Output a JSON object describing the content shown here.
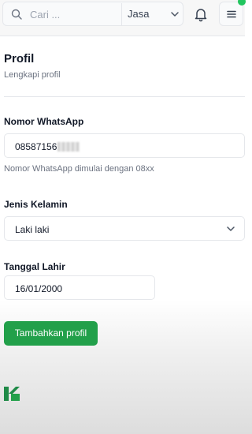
{
  "header": {
    "search": {
      "placeholder": "Cari ..."
    },
    "category": "Jasa",
    "icons": [
      "search-icon",
      "chevron-down-icon",
      "bell-icon",
      "menu-icon"
    ],
    "accent_color": "#22c55e"
  },
  "profile": {
    "title": "Profil",
    "subtitle": "Lengkapi profil"
  },
  "form": {
    "whatsapp": {
      "label": "Nomor WhatsApp",
      "value": "08587156",
      "help": "Nomor WhatsApp dimulai dengan 08xx"
    },
    "gender": {
      "label": "Jenis Kelamin",
      "value": "Laki laki"
    },
    "birthdate": {
      "label": "Tanggal Lahir",
      "value": "16/01/2000"
    },
    "submit_label": "Tambahkan profil",
    "submit_color": "#22a04a"
  }
}
